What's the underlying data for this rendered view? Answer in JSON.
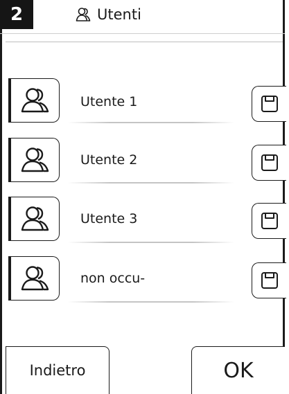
{
  "header": {
    "screen_number": "2",
    "title": "Utenti",
    "title_icon": "user-icon"
  },
  "users": [
    {
      "label": "Utente 1",
      "icon": "user-icon",
      "action_icon": "floppy-disk-icon"
    },
    {
      "label": "Utente 2",
      "icon": "user-icon",
      "action_icon": "floppy-disk-icon"
    },
    {
      "label": "Utente 3",
      "icon": "user-icon",
      "action_icon": "floppy-disk-icon"
    },
    {
      "label": "non occu-",
      "icon": "user-icon",
      "action_icon": "floppy-disk-icon"
    }
  ],
  "footer": {
    "back_label": "Indietro",
    "ok_label": "OK"
  },
  "colors": {
    "ink": "#1a1a1a",
    "badge_bg": "#151515",
    "divider": "#c4c4c4"
  }
}
